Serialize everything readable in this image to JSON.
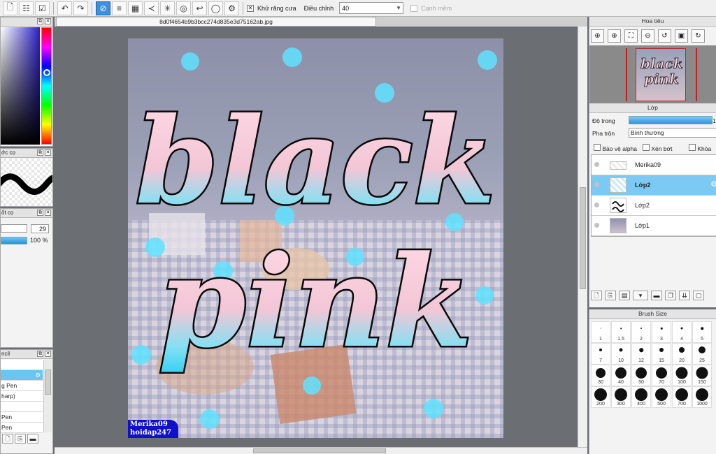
{
  "toolbar": {
    "antialias_label": "Khử răng cưa",
    "adjust_label": "Điều chỉnh",
    "adjust_value": "40",
    "edge_label": "Cạnh mềm"
  },
  "left_panels": {
    "brush_stroke_title": "ớc cọ",
    "size_title": "ốt cọ",
    "size_value": "29",
    "density_value": "100 %",
    "tool_title": "ncil",
    "tool_items": [
      "",
      "",
      "g Pen",
      "harp)",
      "",
      "Pen",
      "Pen"
    ]
  },
  "canvas": {
    "tab_title": "8d0f4654b9b3bcc274d835e3d75162ab.jpg",
    "art_line1": "black",
    "art_line2": "pink",
    "watermark_line1": "Merika09",
    "watermark_line2": "hoidap247"
  },
  "navigator": {
    "title": "Hoa tiêu",
    "thumb_line1": "black",
    "thumb_line2": "pink"
  },
  "layers": {
    "title": "Lớp",
    "opacity_label": "Độ trong",
    "opacity_value": "10",
    "blend_label": "Pha trộn",
    "blend_value": "Bình thường",
    "protect_alpha_label": "Bảo vệ alpha",
    "clipping_label": "Xén bớt",
    "lock_label": "Khóa",
    "items": [
      {
        "name": "Merika09",
        "selected": false
      },
      {
        "name": "Lớp2",
        "selected": true
      },
      {
        "name": "Lớp2",
        "selected": false
      },
      {
        "name": "Lớp1",
        "selected": false
      }
    ]
  },
  "brush_size": {
    "title": "Brush Size",
    "sizes": [
      "1",
      "1.5",
      "2",
      "3",
      "4",
      "5",
      "7",
      "10",
      "12",
      "15",
      "20",
      "25",
      "30",
      "40",
      "50",
      "70",
      "100",
      "150",
      "200",
      "300",
      "400",
      "500",
      "700",
      "1000"
    ]
  },
  "colors": {
    "accent": "#3d8fe0",
    "selection": "#7ccaf4",
    "watermark_bg": "#1010c8"
  }
}
